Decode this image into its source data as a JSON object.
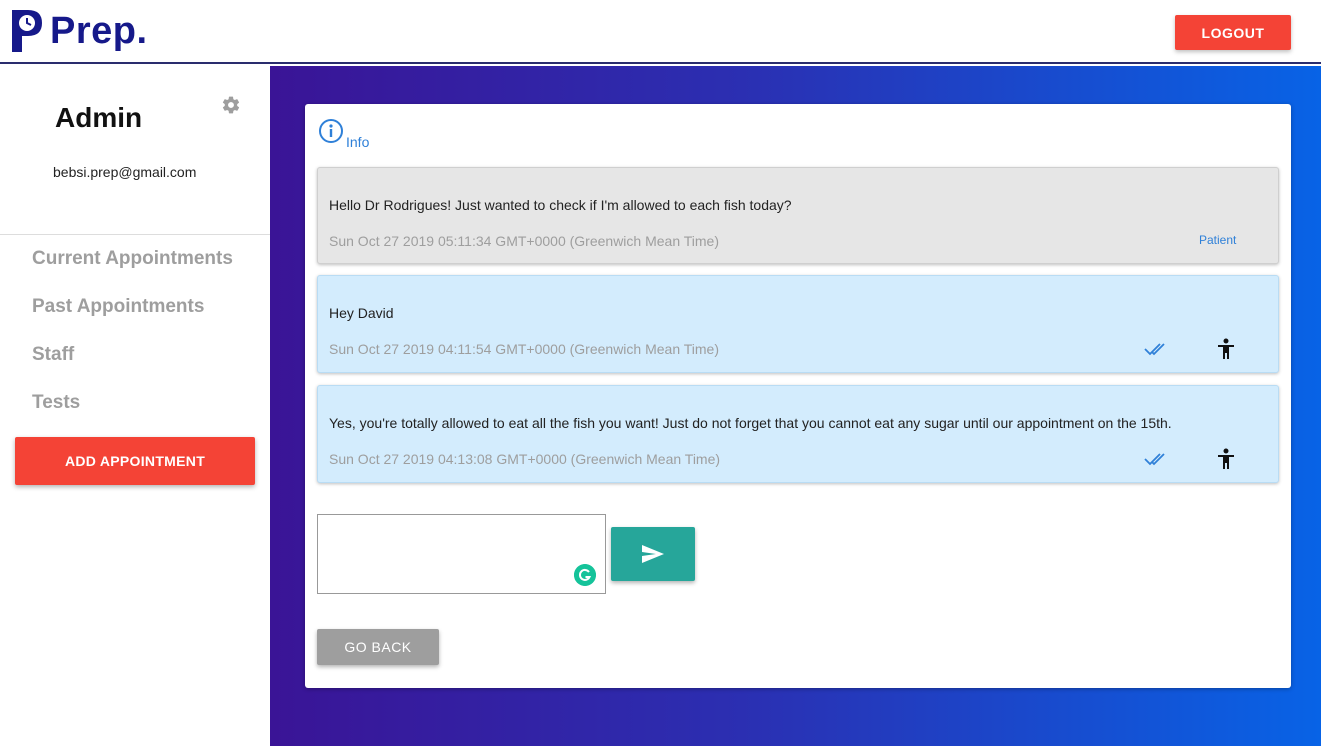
{
  "header": {
    "brand": "Prep.",
    "logout_label": "LOGOUT"
  },
  "sidebar": {
    "admin_name": "Admin",
    "email": "bebsi.prep@gmail.com",
    "items": [
      {
        "label": "Current Appointments"
      },
      {
        "label": "Past Appointments"
      },
      {
        "label": "Staff"
      },
      {
        "label": "Tests"
      }
    ],
    "add_appointment_label": "ADD APPOINTMENT"
  },
  "main": {
    "info_label": "Info",
    "messages": [
      {
        "text": "Hello Dr Rodrigues! Just wanted to check if I'm allowed to each fish today?",
        "time": "Sun Oct 27 2019 05:11:34 GMT+0000 (Greenwich Mean Time)",
        "role": "Patient"
      },
      {
        "text": "Hey David",
        "time": "Sun Oct 27 2019 04:11:54 GMT+0000 (Greenwich Mean Time)"
      },
      {
        "text": "Yes, you're totally allowed to eat all the fish you want! Just do not forget that you cannot eat any sugar until our appointment on the 15th.",
        "time": "Sun Oct 27 2019 04:13:08 GMT+0000 (Greenwich Mean Time)"
      }
    ],
    "compose_value": "",
    "go_back_label": "GO BACK"
  },
  "colors": {
    "brand": "#16198a",
    "accent_red": "#f44336",
    "send_teal": "#26a69a",
    "link_blue": "#2f80d8",
    "patient_bubble": "#e6e6e6",
    "doctor_bubble": "#d3ecfd"
  },
  "icons": [
    "logo-icon",
    "gear-icon",
    "info-icon",
    "double-check-icon",
    "person-icon",
    "send-icon",
    "grammarly-icon"
  ]
}
